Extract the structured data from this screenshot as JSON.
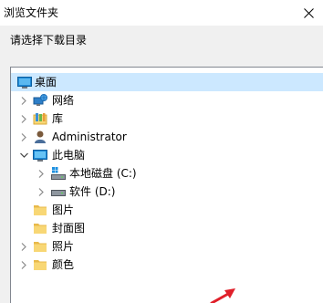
{
  "window": {
    "title": "浏览文件夹",
    "close_label": "✕"
  },
  "prompt": "请选择下载目录",
  "tree": {
    "items": [
      {
        "label": "桌面",
        "selected": true,
        "expander": "none",
        "icon": "desktop-icon"
      },
      {
        "label": "网络",
        "expander": "collapsed",
        "icon": "network-icon"
      },
      {
        "label": "库",
        "expander": "collapsed",
        "icon": "library-icon"
      },
      {
        "label": "Administrator",
        "expander": "collapsed",
        "icon": "user-icon"
      },
      {
        "label": "此电脑",
        "expander": "expanded",
        "icon": "computer-icon"
      },
      {
        "label": "本地磁盘 (C:)",
        "expander": "collapsed",
        "icon": "windows-drive-icon"
      },
      {
        "label": "软件 (D:)",
        "expander": "collapsed",
        "icon": "drive-icon"
      },
      {
        "label": "图片",
        "expander": "none",
        "icon": "folder-icon"
      },
      {
        "label": "封面图",
        "expander": "none",
        "icon": "folder-icon"
      },
      {
        "label": "照片",
        "expander": "collapsed",
        "icon": "folder-icon"
      },
      {
        "label": "颜色",
        "expander": "collapsed",
        "icon": "folder-icon"
      }
    ]
  },
  "colors": {
    "selection": "#cce8ff",
    "folder": "#f8d775",
    "annotation_arrow": "#e0202a"
  }
}
